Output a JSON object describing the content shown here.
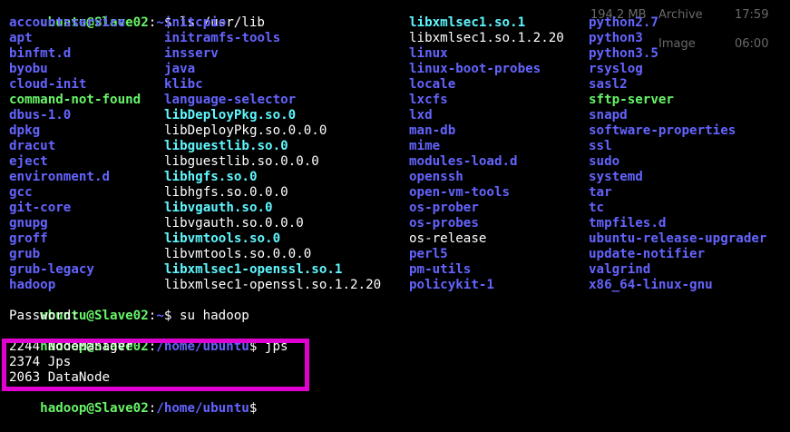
{
  "prompt1": {
    "user": "ubuntu@Slave02",
    "sep": ":",
    "path": "~",
    "sym": "$",
    "cmd": " ls /usr/lib"
  },
  "ls_columns": [
    [
      {
        "name": "accountsservice",
        "kind": "dir"
      },
      {
        "name": "apt",
        "kind": "dir"
      },
      {
        "name": "binfmt.d",
        "kind": "dir"
      },
      {
        "name": "byobu",
        "kind": "dir"
      },
      {
        "name": "cloud-init",
        "kind": "dir"
      },
      {
        "name": "command-not-found",
        "kind": "exec"
      },
      {
        "name": "dbus-1.0",
        "kind": "dir"
      },
      {
        "name": "dpkg",
        "kind": "dir"
      },
      {
        "name": "dracut",
        "kind": "dir"
      },
      {
        "name": "eject",
        "kind": "dir"
      },
      {
        "name": "environment.d",
        "kind": "dir"
      },
      {
        "name": "gcc",
        "kind": "dir"
      },
      {
        "name": "git-core",
        "kind": "dir"
      },
      {
        "name": "gnupg",
        "kind": "dir"
      },
      {
        "name": "groff",
        "kind": "dir"
      },
      {
        "name": "grub",
        "kind": "dir"
      },
      {
        "name": "grub-legacy",
        "kind": "dir"
      },
      {
        "name": "hadoop",
        "kind": "dir"
      }
    ],
    [
      {
        "name": "initcpio",
        "kind": "dir"
      },
      {
        "name": "initramfs-tools",
        "kind": "dir"
      },
      {
        "name": "insserv",
        "kind": "dir"
      },
      {
        "name": "java",
        "kind": "dir"
      },
      {
        "name": "klibc",
        "kind": "dir"
      },
      {
        "name": "language-selector",
        "kind": "dir"
      },
      {
        "name": "libDeployPkg.so.0",
        "kind": "link"
      },
      {
        "name": "libDeployPkg.so.0.0.0",
        "kind": "file"
      },
      {
        "name": "libguestlib.so.0",
        "kind": "link"
      },
      {
        "name": "libguestlib.so.0.0.0",
        "kind": "file"
      },
      {
        "name": "libhgfs.so.0",
        "kind": "link"
      },
      {
        "name": "libhgfs.so.0.0.0",
        "kind": "file"
      },
      {
        "name": "libvgauth.so.0",
        "kind": "link"
      },
      {
        "name": "libvgauth.so.0.0.0",
        "kind": "file"
      },
      {
        "name": "libvmtools.so.0",
        "kind": "link"
      },
      {
        "name": "libvmtools.so.0.0.0",
        "kind": "file"
      },
      {
        "name": "libxmlsec1-openssl.so.1",
        "kind": "link"
      },
      {
        "name": "libxmlsec1-openssl.so.1.2.20",
        "kind": "file"
      }
    ],
    [
      {
        "name": "libxmlsec1.so.1",
        "kind": "link"
      },
      {
        "name": "libxmlsec1.so.1.2.20",
        "kind": "file"
      },
      {
        "name": "linux",
        "kind": "dir"
      },
      {
        "name": "linux-boot-probes",
        "kind": "dir"
      },
      {
        "name": "locale",
        "kind": "dir"
      },
      {
        "name": "lxcfs",
        "kind": "dir"
      },
      {
        "name": "lxd",
        "kind": "dir"
      },
      {
        "name": "man-db",
        "kind": "dir"
      },
      {
        "name": "mime",
        "kind": "dir"
      },
      {
        "name": "modules-load.d",
        "kind": "dir"
      },
      {
        "name": "openssh",
        "kind": "dir"
      },
      {
        "name": "open-vm-tools",
        "kind": "dir"
      },
      {
        "name": "os-prober",
        "kind": "dir"
      },
      {
        "name": "os-probes",
        "kind": "dir"
      },
      {
        "name": "os-release",
        "kind": "file"
      },
      {
        "name": "perl5",
        "kind": "dir"
      },
      {
        "name": "pm-utils",
        "kind": "dir"
      },
      {
        "name": "policykit-1",
        "kind": "dir"
      }
    ],
    [
      {
        "name": "python2.7",
        "kind": "dir"
      },
      {
        "name": "python3",
        "kind": "dir"
      },
      {
        "name": "python3.5",
        "kind": "dir"
      },
      {
        "name": "rsyslog",
        "kind": "dir"
      },
      {
        "name": "sasl2",
        "kind": "dir"
      },
      {
        "name": "sftp-server",
        "kind": "exec"
      },
      {
        "name": "snapd",
        "kind": "dir"
      },
      {
        "name": "software-properties",
        "kind": "dir"
      },
      {
        "name": "ssl",
        "kind": "dir"
      },
      {
        "name": "sudo",
        "kind": "dir"
      },
      {
        "name": "systemd",
        "kind": "dir"
      },
      {
        "name": "tar",
        "kind": "dir"
      },
      {
        "name": "tc",
        "kind": "dir"
      },
      {
        "name": "tmpfiles.d",
        "kind": "dir"
      },
      {
        "name": "ubuntu-release-upgrader",
        "kind": "dir"
      },
      {
        "name": "update-notifier",
        "kind": "dir"
      },
      {
        "name": "valgrind",
        "kind": "dir"
      },
      {
        "name": "x86_64-linux-gnu",
        "kind": "dir"
      }
    ]
  ],
  "prompt2": {
    "user": "ubuntu@Slave02",
    "sep": ":",
    "path": "~",
    "sym": "$",
    "cmd": " su hadoop"
  },
  "password_line": "Password:",
  "prompt3": {
    "user": "hadoop@Slave02",
    "sep": ":",
    "path": "/home/ubuntu",
    "sym": "$",
    "cmd": " jps"
  },
  "jps_output": [
    "2244 NodeManager",
    "2374 Jps",
    "2063 DataNode"
  ],
  "prompt4": {
    "user": "hadoop@Slave02",
    "sep": ":",
    "path": "/home/ubuntu",
    "sym": "$",
    "cmd": ""
  },
  "background_overlay": {
    "size": "194.2 MB",
    "type1": "Archive",
    "time1": "17:59",
    "type2": "Image",
    "time2": "06:00"
  },
  "colors": {
    "directory": "#6464ff",
    "symlink": "#5ff7ff",
    "executable": "#68f568",
    "highlight_box": "#e000d0"
  }
}
